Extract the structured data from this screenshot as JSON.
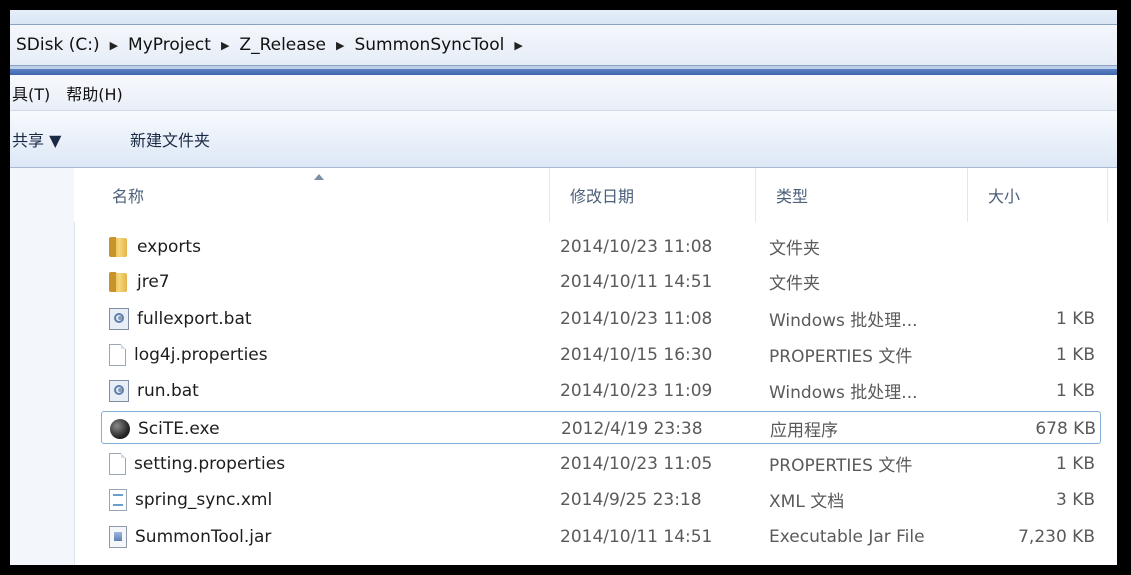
{
  "breadcrumb": [
    "SDisk (C:)",
    "MyProject",
    "Z_Release",
    "SummonSyncTool"
  ],
  "menu": [
    {
      "label": "具(T)"
    },
    {
      "label": "帮助(H)"
    }
  ],
  "toolbar": {
    "share_label": "共享 ▼",
    "new_folder_label": "新建文件夹"
  },
  "columns": {
    "name": "名称",
    "date": "修改日期",
    "type": "类型",
    "size": "大小"
  },
  "files": [
    {
      "name": "exports",
      "date": "2014/10/23 11:08",
      "type": "文件夹",
      "size": "",
      "icon": "folder-icon"
    },
    {
      "name": "jre7",
      "date": "2014/10/11 14:51",
      "type": "文件夹",
      "size": "",
      "icon": "folder-icon"
    },
    {
      "name": "fullexport.bat",
      "date": "2014/10/23 11:08",
      "type": "Windows 批处理...",
      "size": "1 KB",
      "icon": "bat-icon"
    },
    {
      "name": "log4j.properties",
      "date": "2014/10/15 16:30",
      "type": "PROPERTIES 文件",
      "size": "1 KB",
      "icon": "file-icon"
    },
    {
      "name": "run.bat",
      "date": "2014/10/23 11:09",
      "type": "Windows 批处理...",
      "size": "1 KB",
      "icon": "bat-icon"
    },
    {
      "name": "SciTE.exe",
      "date": "2012/4/19 23:38",
      "type": "应用程序",
      "size": "678 KB",
      "icon": "scite-icon"
    },
    {
      "name": "setting.properties",
      "date": "2014/10/23 11:05",
      "type": "PROPERTIES 文件",
      "size": "1 KB",
      "icon": "file-icon"
    },
    {
      "name": "spring_sync.xml",
      "date": "2014/9/25 23:18",
      "type": "XML 文档",
      "size": "3 KB",
      "icon": "xml-icon"
    },
    {
      "name": "SummonTool.jar",
      "date": "2014/10/11 14:51",
      "type": "Executable Jar File",
      "size": "7,230 KB",
      "icon": "jar-icon"
    }
  ]
}
